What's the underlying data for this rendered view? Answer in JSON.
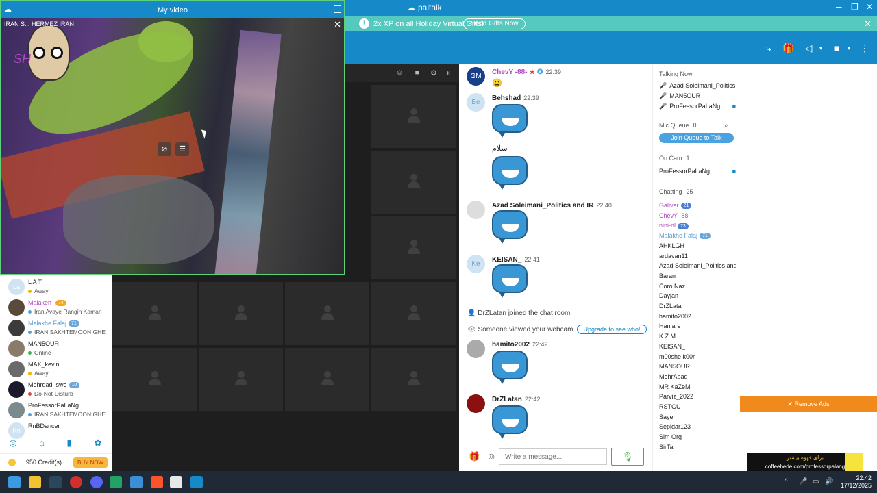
{
  "app": {
    "name": "paltalk"
  },
  "notification": {
    "text": "2x XP on all Holiday Virtual Gifts!",
    "button": "Send Gifts Now"
  },
  "my_video": {
    "title": "My video",
    "caption": "IRAN S... HERMEZ IRAN",
    "signature": "SH"
  },
  "left_users": [
    {
      "name": "L A T",
      "status": "Away",
      "avatar": "La",
      "dot": "#f5b400"
    },
    {
      "name": "Malakeh-",
      "status": "Iran Avaye Rangin Kaman",
      "badge": "74",
      "badge_color": "#f5a623",
      "avatar": "",
      "dot": "",
      "name_color": "#b04bc1"
    },
    {
      "name": "Malakhe Falaj",
      "status": "IRAN SAKHTEMOON GHE",
      "badge": "71",
      "badge_color": "#6aa6d8",
      "avatar": "",
      "dot": "",
      "name_color": "#5a9bd4"
    },
    {
      "name": "MAN5OUR",
      "status": "Online",
      "avatar": "",
      "dot": "#3ab54a"
    },
    {
      "name": "MAX_kevin",
      "status": "Away",
      "avatar": "",
      "dot": "#f5b400"
    },
    {
      "name": "Mehrdad_swe",
      "status": "Do-Not-Disturb",
      "badge": "10",
      "badge_color": "#6aa6d8",
      "avatar": "",
      "dot": "#e0453a"
    },
    {
      "name": "ProFessorPaLaNg",
      "status": "IRAN SAKHTEMOON GHE",
      "avatar": "",
      "dot": ""
    },
    {
      "name": "RnBDancer",
      "status": "",
      "avatar": "Rn",
      "dot": ""
    }
  ],
  "credits": {
    "text": "950 Credit(s)",
    "buy": "BUY NOW"
  },
  "chat": {
    "messages": [
      {
        "user": "ChevY -88-",
        "time": "22:39",
        "avatar": "GM",
        "color": "#b04bc1"
      },
      {
        "user": "Behshad",
        "time": "22:39",
        "avatar": "Be",
        "color": "#222",
        "text": "سلام"
      },
      {
        "user": "Azad Soleimani_Politics and IR",
        "time": "22:40",
        "avatar": "",
        "color": "#222"
      },
      {
        "user": "KEISAN_",
        "time": "22:41",
        "avatar": "Ke",
        "color": "#222"
      },
      {
        "user": "hamito2002",
        "time": "22:42",
        "avatar": "",
        "color": "#222"
      },
      {
        "user": "DrZLatan",
        "time": "22:42",
        "avatar": "",
        "color": "#222"
      }
    ],
    "system": {
      "joined": "DrZLatan joined the chat room",
      "viewed": "Someone viewed your webcam",
      "upgrade": "Upgrade to see who!"
    },
    "composer_placeholder": "Write a message..."
  },
  "room": {
    "talking_now_label": "Talking Now",
    "talking_now": [
      "Azad Soleimani_Politics a",
      "MAN5OUR",
      "ProFessorPaLaNg"
    ],
    "mic_queue_label": "Mic Queue",
    "mic_queue_count": "0",
    "join_queue": "Join Queue to Talk",
    "on_cam_label": "On Cam",
    "on_cam_count": "1",
    "on_cam": [
      "ProFessorPaLaNg"
    ],
    "chatting_label": "Chatting",
    "chatting_count": "25",
    "chatting": [
      {
        "name": "Galiver",
        "badge": "21",
        "color": "#b04bc1"
      },
      {
        "name": "ChevY -88-",
        "color": "#b04bc1"
      },
      {
        "name": "nini-nl",
        "badge": "73",
        "color": "#b04bc1"
      },
      {
        "name": "Malakhe Falaj",
        "badge": "71",
        "color": "#5a9bd4"
      },
      {
        "name": "AHKLGH"
      },
      {
        "name": "ardavan11"
      },
      {
        "name": "Azad Soleimani_Politics and"
      },
      {
        "name": "Baran"
      },
      {
        "name": "Coro Naz"
      },
      {
        "name": "Dayjan"
      },
      {
        "name": "DrZLatan"
      },
      {
        "name": "hamito2002"
      },
      {
        "name": "Hanjare"
      },
      {
        "name": "K Z M"
      },
      {
        "name": "KEISAN_"
      },
      {
        "name": "m00she k00r"
      },
      {
        "name": "MAN5OUR"
      },
      {
        "name": "MehrAbad"
      },
      {
        "name": "MR KaZeM"
      },
      {
        "name": "Parviz_2022"
      },
      {
        "name": "RSTGU"
      },
      {
        "name": "Sayeh"
      },
      {
        "name": "Sepidar123"
      },
      {
        "name": "Sim Org"
      },
      {
        "name": "SirTa"
      }
    ]
  },
  "ads": {
    "remove": "✕ Remove Ads",
    "banner_line1": "برای قهوه بیشتر",
    "banner_line2": "coffeebede.com/professorpalang"
  },
  "taskbar": {
    "time": "22:42",
    "date": "17/12/2025"
  }
}
